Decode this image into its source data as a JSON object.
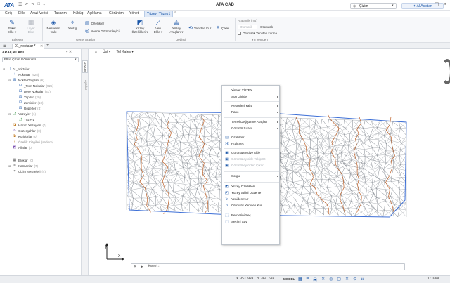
{
  "app": {
    "logo": "ATA",
    "title": "ATA CAD",
    "quick_access": [
      "☰",
      "↶",
      "↷",
      "□",
      "▾"
    ]
  },
  "account": {
    "label": "Çizim",
    "signin": "Al Asistan"
  },
  "tabs": [
    "Giriş",
    "Ekle",
    "Arazi Verisi",
    "Tasarım",
    "Kübüg",
    "Açıklama",
    "Görünüm",
    "Yönet",
    "Yüzey: Yüzey1"
  ],
  "ribbon": {
    "b_editor": "Etiket\nEkle ▾",
    "b_layer": "Layer\nEkle",
    "b_objects": "Nesneleri\nYalıt",
    "b_isolate": "Yalıtıg",
    "b_props": "Özellikler",
    "b_propview": "Nesne Görüntüleyici",
    "b_surf_props": "Yüzey\nÖzellikleri ▾",
    "b_data": "Veri\nEkle ▾",
    "b_tools": "Yüzey\nAraçları ▾",
    "b_rebuild": "Yeniden Kur",
    "b_extract": "Çıkar",
    "a_label": "Ara anlik (ms)",
    "a_auto": "Otomatik",
    "a_auto2": "Otomatik",
    "a_auto_rebuild": "Otomatik Yeniden kurma",
    "g_labels": "Etiketler",
    "g_general": "Genel Araçlar",
    "g_modify": "Değiştir",
    "g_recent": "Yü Yeniden"
  },
  "doc_tab": "01_noktalar *",
  "sidebar": {
    "title": "ARAÇ ALANI",
    "view_select": "Etkin Çizim Görünümü",
    "items": [
      {
        "label": "01_noktalar",
        "count": ""
      },
      {
        "label": "Noktalar",
        "count": "(925)"
      },
      {
        "label": "Nokta Grupları",
        "count": "(6)"
      },
      {
        "label": "_Tüm Noktalar",
        "count": "(925)"
      },
      {
        "label": "Dere Noktalar",
        "count": "(41)"
      },
      {
        "label": "Yapılar",
        "count": "(20)"
      },
      {
        "label": "Zeminler",
        "count": "(10)"
      },
      {
        "label": "Röperler",
        "count": "(4)"
      },
      {
        "label": "Yüzeyler",
        "count": "(1)"
      },
      {
        "label": "Yüzey1",
        "count": ""
      },
      {
        "label": "Hacim Yüzeyleri",
        "count": "(0)"
      },
      {
        "label": "Güzergahlar",
        "count": "(0)"
      },
      {
        "label": "Koridorlar",
        "count": "(0)"
      },
      {
        "label": "Özellik Çizgileri",
        "count": "(sadece)"
      },
      {
        "label": "Alfalar",
        "count": "(0)"
      },
      {
        "label": "Bloklar",
        "count": "(0)"
      },
      {
        "label": "Katmanlar",
        "count": "(7)"
      },
      {
        "label": "Çizim Nesneleri",
        "count": "(4)"
      }
    ]
  },
  "vtabs": [
    "Gezgin",
    "Ayarlar"
  ],
  "view": {
    "view_name": "Üst ▾",
    "style_name": "Tel Kafes ▾",
    "home": "⌂"
  },
  "context_menu": [
    {
      "label": "Yinele: YÜZEY",
      "icon": "",
      "arrow": false,
      "disabled": false
    },
    {
      "label": "Son Girişler",
      "icon": "",
      "arrow": true,
      "disabled": false
    },
    {
      "label": "Nesneleri Yalıt",
      "icon": "",
      "arrow": true,
      "disabled": false
    },
    {
      "label": "Pano",
      "icon": "",
      "arrow": true,
      "disabled": false
    },
    {
      "label": "Temel Değiştirme Araçları",
      "icon": "",
      "arrow": true,
      "disabled": false
    },
    {
      "label": "Görüntü Sırası",
      "icon": "",
      "arrow": true,
      "disabled": false
    },
    {
      "label": "Özellikler",
      "icon": "▤",
      "arrow": false,
      "disabled": false
    },
    {
      "label": "Hızlı Seç",
      "icon": "⌘",
      "arrow": false,
      "disabled": false
    },
    {
      "label": "Görüntüleyiciye Ekle",
      "icon": "▣",
      "arrow": false,
      "disabled": false
    },
    {
      "label": "Görüntüleyicide Takip Et",
      "icon": "▣",
      "arrow": false,
      "disabled": true
    },
    {
      "label": "Görüntüleyiciden Çıkar",
      "icon": "▣",
      "arrow": false,
      "disabled": true
    },
    {
      "label": "Sorgu",
      "icon": "",
      "arrow": true,
      "disabled": false
    },
    {
      "label": "Yüzey Özellikleri",
      "icon": "◩",
      "arrow": false,
      "disabled": false
    },
    {
      "label": "Yüzey Stilini Düzenle",
      "icon": "◩",
      "arrow": false,
      "disabled": false
    },
    {
      "label": "Yeniden Kur",
      "icon": "↻",
      "arrow": false,
      "disabled": false
    },
    {
      "label": "Otomatik Yeniden Kur",
      "icon": "↻",
      "arrow": false,
      "disabled": false
    },
    {
      "label": "Benzerini Seç",
      "icon": "⬚",
      "arrow": false,
      "disabled": false
    },
    {
      "label": "Seçimi Say",
      "icon": "⬚",
      "arrow": false,
      "disabled": false
    }
  ],
  "cmdline": {
    "close": "✕",
    "arrow": "▸",
    "input_value": "Komut:"
  },
  "status": {
    "x": "X 353.983",
    "y": "Y 464.508",
    "model": "MODEL",
    "scale": "1:1000",
    "icons": [
      "▦",
      "⌗",
      "⦿",
      "✕",
      "◎",
      "▢",
      "✕",
      "⊙",
      "☷"
    ]
  },
  "ucs": {
    "x": "X",
    "y": "Y"
  },
  "colors": {
    "accent": "#1a56a8",
    "boundary": "#3d6fd6",
    "contour": "#c0632a",
    "tin": "#8a8f96"
  }
}
